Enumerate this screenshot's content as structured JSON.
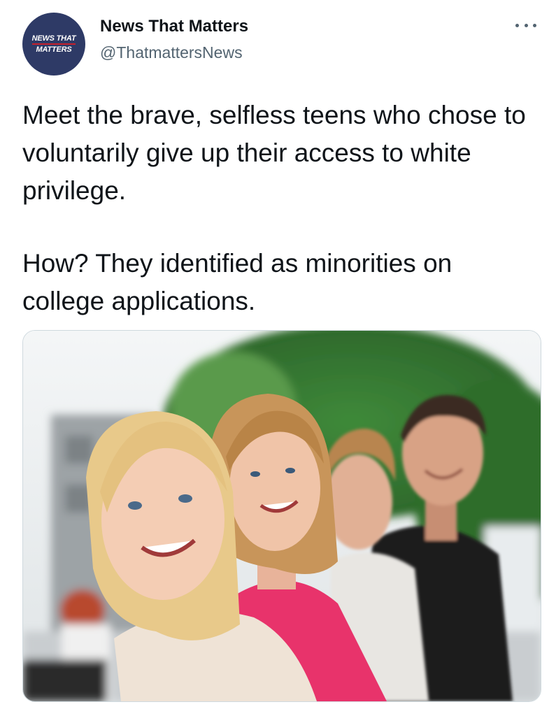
{
  "tweet": {
    "author": {
      "name": "News That Matters",
      "handle": "@ThatmattersNews",
      "avatar_text_line1": "NEWS THAT",
      "avatar_text_line2": "MATTERS"
    },
    "paragraphs": [
      "Meet the brave, selfless teens who chose to voluntarily give up their access to white privilege.",
      "How? They identified as minorities on college applications."
    ],
    "more_icon": "ellipsis-icon",
    "media": {
      "type": "photo",
      "description_icon": "photo-of-four-smiling-teens"
    }
  },
  "colors": {
    "text": "#0f1419",
    "secondary": "#536471",
    "avatar_bg": "#2e3a66",
    "avatar_accent": "#c8202c",
    "border": "#cfd9de"
  }
}
